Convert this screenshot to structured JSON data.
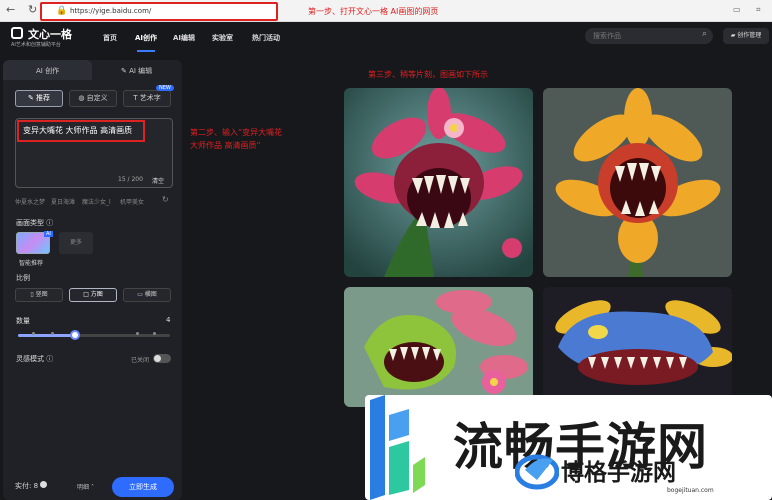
{
  "browser": {
    "url": "https://yige.baidu.com/",
    "annotation_step1": "第一步、打开文心一格 AI画图的网页"
  },
  "site": {
    "logo_title": "文心一格",
    "logo_subtitle": "AI艺术和创意辅助平台",
    "nav": [
      "首页",
      "AI创作",
      "AI编辑",
      "实验室",
      "热门活动"
    ],
    "search_placeholder": "搜索作品",
    "create_manage": "创作管理"
  },
  "panel": {
    "tabs": [
      "AI 创作",
      "AI 编辑"
    ],
    "modes": [
      "推荐",
      "自定义",
      "艺术字"
    ],
    "new_badge": "NEW",
    "prompt": "变异大嘴花 大师作品 高清画质",
    "counter": "15 / 200",
    "clear": "清空",
    "suggestions": [
      "仲夏水之梦",
      "夏日海滩",
      "魔法少女_l",
      "机甲美女"
    ],
    "style_section": "画面类型",
    "style_ai_tag": "AI",
    "style_more": "更多",
    "style_selected": "智能推荐",
    "ratio_section": "比例",
    "ratios": [
      "竖图",
      "方图",
      "横图"
    ],
    "count_section": "数量",
    "count_value": "4",
    "inspiration_section": "灵感模式",
    "inspiration_state": "已关闭",
    "credits_label": "实付:",
    "credits_value": "8",
    "expand": "明细",
    "generate": "立即生成"
  },
  "annotations": {
    "step2_line1": "第二步、输入“变异大嘴花",
    "step2_line2": "大师作品 高清画质”",
    "step3": "第三步、稍等片刻，图画如下所示"
  },
  "watermark": {
    "big": "流畅手游网",
    "small": "博格手游网",
    "url": "bogejituan.com"
  },
  "colors": {
    "accent": "#2e6bff",
    "annotation": "#e02020",
    "background": "#17181c"
  }
}
